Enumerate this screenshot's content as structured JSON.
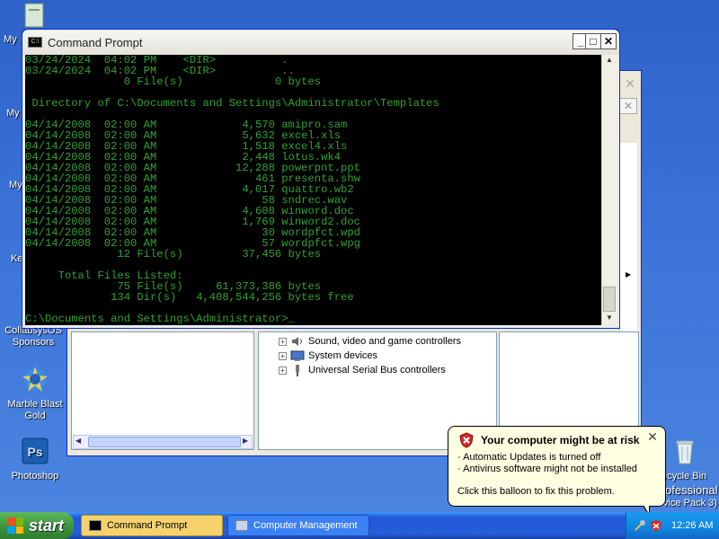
{
  "desktop": {
    "icons": [
      {
        "label": "CollabsysOS Sponsors",
        "icon": "sponsors-icon"
      },
      {
        "label": "Marble Blast Gold",
        "icon": "marble-blast-icon"
      },
      {
        "label": "Photoshop",
        "icon": "photoshop-icon"
      },
      {
        "label": "Recycle Bin",
        "icon": "recycle-bin-icon"
      }
    ],
    "cut_labels": [
      "My",
      "My",
      "My",
      "Ke"
    ],
    "watermark": {
      "line1": "ecycle Bin",
      "line2": "ofessional",
      "line3": "vice Pack 3)"
    }
  },
  "computer_management": {
    "device_tree": [
      {
        "label": "Sound, video and game controllers",
        "icon": "sound-icon"
      },
      {
        "label": "System devices",
        "icon": "system-devices-icon"
      },
      {
        "label": "Universal Serial Bus controllers",
        "icon": "usb-icon"
      }
    ],
    "close_glyph": "✕",
    "expand_glyph": "+"
  },
  "command_prompt": {
    "title": "Command Prompt",
    "icon_text": "C:\\",
    "buttons": {
      "minimize": "_",
      "maximize": "□",
      "close": "✕"
    },
    "lines": [
      "03/24/2024  04:02 PM    <DIR>          .",
      "03/24/2024  04:02 PM    <DIR>          ..",
      "               0 File(s)              0 bytes",
      "",
      " Directory of C:\\Documents and Settings\\Administrator\\Templates",
      "",
      "04/14/2008  02:00 AM             4,570 amipro.sam",
      "04/14/2008  02:00 AM             5,632 excel.xls",
      "04/14/2008  02:00 AM             1,518 excel4.xls",
      "04/14/2008  02:00 AM             2,448 lotus.wk4",
      "04/14/2008  02:00 AM            12,288 powerpnt.ppt",
      "04/14/2008  02:00 AM               461 presenta.shw",
      "04/14/2008  02:00 AM             4,017 quattro.wb2",
      "04/14/2008  02:00 AM                58 sndrec.wav",
      "04/14/2008  02:00 AM             4,608 winword.doc",
      "04/14/2008  02:00 AM             1,769 winword2.doc",
      "04/14/2008  02:00 AM                30 wordpfct.wpd",
      "04/14/2008  02:00 AM                57 wordpfct.wpg",
      "              12 File(s)         37,456 bytes",
      "",
      "     Total Files Listed:",
      "              75 File(s)     61,373,386 bytes",
      "             134 Dir(s)   4,408,544,256 bytes free",
      "",
      "C:\\Documents and Settings\\Administrator>_"
    ]
  },
  "balloon": {
    "title": "Your computer might be at risk",
    "lines": [
      "· Automatic Updates is turned off",
      "· Antivirus software might not be installed"
    ],
    "action": "Click this balloon to fix this problem.",
    "close_glyph": "✕"
  },
  "taskbar": {
    "start_label": "start",
    "tasks": [
      {
        "label": "Command Prompt",
        "active": true
      },
      {
        "label": "Computer Management",
        "active": false
      }
    ],
    "clock": "12:26 AM"
  },
  "colors": {
    "console_text": "#2fa32f",
    "console_bg": "#000000",
    "balloon_bg": "#ffffe1",
    "taskbar": "#245edb",
    "start_button": "#3c8f3c"
  }
}
